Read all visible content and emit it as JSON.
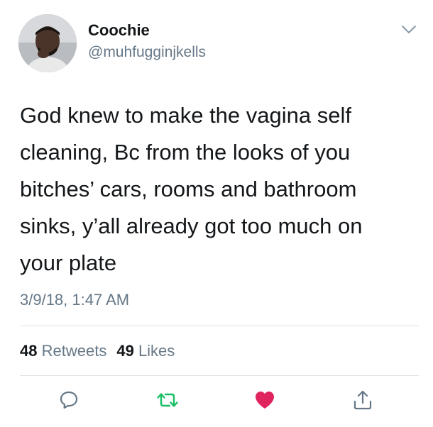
{
  "author": {
    "name": "Coochie",
    "handle": "@muhfugginjkells",
    "avatar_icon": "profile-photo"
  },
  "tweet": {
    "lines": [
      "God knew to make the vagina self",
      "cleaning, Bc from the looks of you",
      "bitches’ cars, rooms and bathroom",
      "sinks, y’all already got too much on",
      "your plate"
    ],
    "timestamp": "3/9/18, 1:47 AM"
  },
  "stats": {
    "retweets_count": "48",
    "retweets_label": "Retweets",
    "likes_count": "49",
    "likes_label": "Likes"
  },
  "actions": {
    "reply_icon": "reply-icon",
    "retweet_icon": "retweet-icon",
    "like_icon": "heart-icon",
    "share_icon": "share-icon"
  },
  "colors": {
    "text": "#14171a",
    "secondary": "#657786",
    "retweet_green": "#17bf63",
    "like_red": "#e0245e",
    "divider": "#dde3e8"
  }
}
